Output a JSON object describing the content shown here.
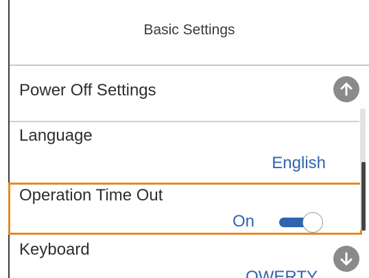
{
  "header": {
    "title": "Basic Settings"
  },
  "settings": {
    "items": [
      {
        "label": "Power Off Settings",
        "value": ""
      },
      {
        "label": "Language",
        "value": "English"
      },
      {
        "label": "Operation Time Out",
        "value": "On",
        "toggle_state": "on"
      },
      {
        "label": "Keyboard",
        "value": "QWERTY"
      }
    ]
  },
  "icons": {
    "scroll_up": "arrow-up-circle-icon",
    "scroll_down": "arrow-down-circle-icon"
  },
  "colors": {
    "highlight": "#e58a22",
    "value_text": "#2f64b0",
    "toggle_on": "#2f64b0"
  }
}
